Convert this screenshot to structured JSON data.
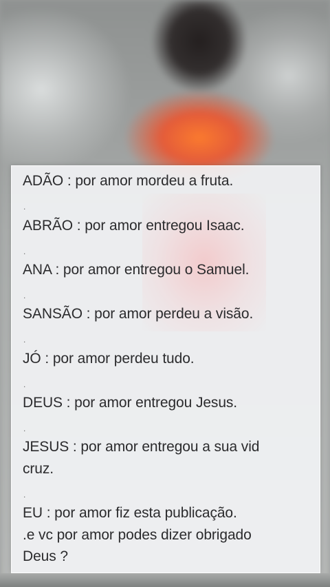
{
  "lines": [
    "ADÃO : por amor mordeu a fruta.",
    "ABRÃO : por amor entregou Isaac.",
    "ANA : por amor entregou o Samuel.",
    "SANSÃO : por amor perdeu a visão.",
    "JÓ : por amor perdeu tudo.",
    "DEUS : por amor entregou Jesus.",
    "JESUS : por amor entregou a sua vid",
    "cruz.",
    "EU : por amor fiz esta publicação.",
    ".e vc por amor podes dizer obrigado",
    "Deus ?"
  ],
  "separator": "."
}
